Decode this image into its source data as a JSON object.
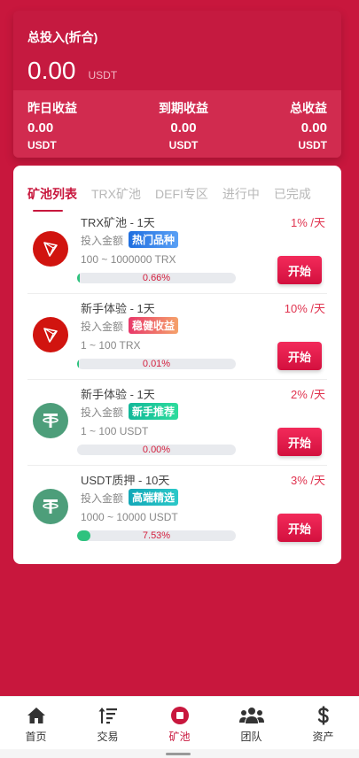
{
  "summary": {
    "title": "总投入(折合)",
    "amount": "0.00",
    "unit": "USDT",
    "stats": [
      {
        "label": "昨日收益",
        "value": "0.00",
        "unit": "USDT"
      },
      {
        "label": "到期收益",
        "value": "0.00",
        "unit": "USDT"
      },
      {
        "label": "总收益",
        "value": "0.00",
        "unit": "USDT"
      }
    ]
  },
  "tabs": [
    "矿池列表",
    "TRX矿池",
    "DEFI专区",
    "进行中",
    "已完成"
  ],
  "invest_label": "投入金额",
  "start_label": "开始",
  "items": [
    {
      "name": "TRX矿池 - 1天",
      "rate": "1% /天",
      "badge": "热门品种",
      "range": "100 ~ 1000000 TRX",
      "progress": "0.66%",
      "progress_value": 0.66,
      "coin": "trx"
    },
    {
      "name": "新手体验 - 1天",
      "rate": "10% /天",
      "badge": "稳健收益",
      "range": "1 ~ 100 TRX",
      "progress": "0.01%",
      "progress_value": 0.01,
      "coin": "trx"
    },
    {
      "name": "新手体验 - 1天",
      "rate": "2% /天",
      "badge": "新手推荐",
      "range": "1 ~ 100 USDT",
      "progress": "0.00%",
      "progress_value": 0.0,
      "coin": "usdt"
    },
    {
      "name": "USDT质押 - 10天",
      "rate": "3% /天",
      "badge": "高端精选",
      "range": "1000 ~ 10000 USDT",
      "progress": "7.53%",
      "progress_value": 7.53,
      "coin": "usdt"
    }
  ],
  "nav": [
    {
      "label": "首页",
      "icon": "home-icon"
    },
    {
      "label": "交易",
      "icon": "sort-icon"
    },
    {
      "label": "矿池",
      "icon": "stop-circle-icon"
    },
    {
      "label": "团队",
      "icon": "users-icon"
    },
    {
      "label": "资产",
      "icon": "dollar-icon"
    }
  ],
  "colors": {
    "brand": "#c8173d",
    "accent": "#e0334f",
    "progress": "#2ec27e"
  }
}
